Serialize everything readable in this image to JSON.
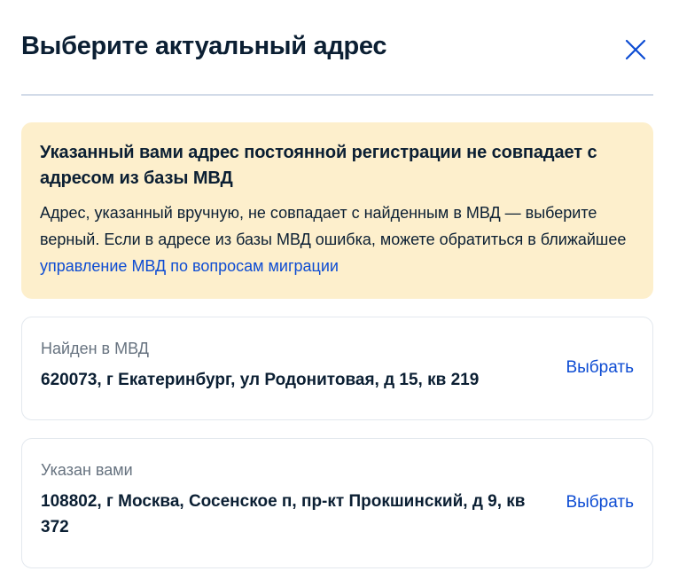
{
  "modal": {
    "title": "Выберите актуальный адрес",
    "close_icon": "close-icon"
  },
  "alert": {
    "title": "Указанный вами адрес постоянной регистрации не совпадает с адресом из базы МВД",
    "text": "Адрес, указанный вручную, не совпадает с найденным в МВД — выберите верный. Если в адресе из базы МВД ошибка, можете обратиться в ближайшее ",
    "link_text": "управление МВД по вопросам миграции",
    "background_color": "#fdefcc",
    "link_color": "#0d4cd3"
  },
  "options": [
    {
      "label": "Найден в МВД",
      "address": "620073, г Екатеринбург, ул Родонитовая, д 15, кв 219",
      "action": "Выбрать"
    },
    {
      "label": "Указан вами",
      "address": "108802, г Москва, Сосенское п, пр-кт Прокшинский, д 9, кв 372",
      "action": "Выбрать"
    }
  ],
  "colors": {
    "text": "#0b1f33",
    "muted": "#66727f",
    "accent": "#0d4cd3",
    "divider": "#d2dbe8"
  }
}
